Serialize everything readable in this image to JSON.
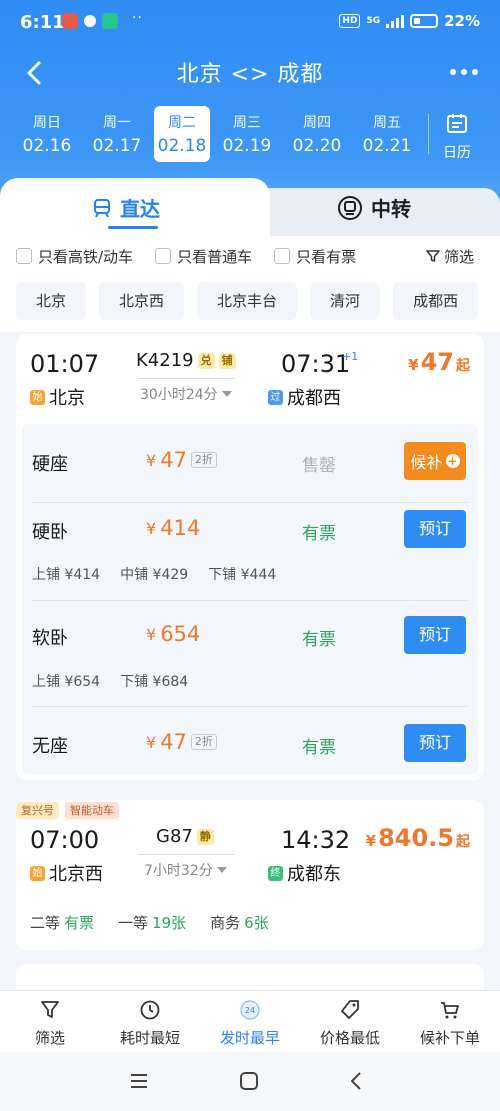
{
  "status_bar": {
    "time": "6:11",
    "network_label": "HD",
    "network_type": "5G",
    "battery": "22%",
    "more_dots": "··"
  },
  "nav": {
    "title": "北京 <> 成都",
    "back_icon": "back-arrow-icon",
    "more_icon": "more-dots-icon"
  },
  "dates": [
    {
      "weekday": "周日",
      "date": "02.16",
      "selected": false
    },
    {
      "weekday": "周一",
      "date": "02.17",
      "selected": false
    },
    {
      "weekday": "周二",
      "date": "02.18",
      "selected": true
    },
    {
      "weekday": "周三",
      "date": "02.19",
      "selected": false
    },
    {
      "weekday": "周四",
      "date": "02.20",
      "selected": false
    },
    {
      "weekday": "周五",
      "date": "02.21",
      "selected": false
    }
  ],
  "calendar_label": "日历",
  "tabs": {
    "direct": "直达",
    "transfer": "中转"
  },
  "filters": {
    "high_speed": "只看高铁/动车",
    "normal": "只看普通车",
    "available": "只看有票",
    "filter_btn": "筛选"
  },
  "stations": [
    "北京",
    "北京西",
    "北京丰台",
    "清河",
    "成都西"
  ],
  "train1": {
    "depart_time": "01:07",
    "depart_station": "北京",
    "depart_tag": "始",
    "number": "K4219",
    "tag_exchange": "兑",
    "tag_berth": "铺",
    "duration": "30小时24分",
    "arrive_time": "07:31",
    "arrive_plus": "+1",
    "arrive_station": "成都西",
    "arrive_tag": "过",
    "price_currency": "¥",
    "price": "47",
    "price_suffix": "起",
    "seats": [
      {
        "name": "硬座",
        "currency": "¥",
        "price": "47",
        "discount": "2折",
        "status": "售罄",
        "action": "候补"
      },
      {
        "name": "硬卧",
        "currency": "¥",
        "price": "414",
        "status": "有票",
        "action": "预订",
        "berths": [
          "上铺 ¥414",
          "中铺 ¥429",
          "下铺 ¥444"
        ]
      },
      {
        "name": "软卧",
        "currency": "¥",
        "price": "654",
        "status": "有票",
        "action": "预订",
        "berths": [
          "上铺 ¥654",
          "下铺 ¥684"
        ]
      },
      {
        "name": "无座",
        "currency": "¥",
        "price": "47",
        "discount": "2折",
        "status": "有票",
        "action": "预订"
      }
    ]
  },
  "train2": {
    "tag1": "复兴号",
    "tag2": "智能动车",
    "depart_time": "07:00",
    "depart_station": "北京西",
    "depart_tag": "始",
    "number": "G87",
    "tag_quiet": "静",
    "duration": "7小时32分",
    "arrive_time": "14:32",
    "arrive_station": "成都东",
    "arrive_tag": "终",
    "price_currency": "¥",
    "price": "840.5",
    "price_suffix": "起",
    "classes": [
      {
        "name": "二等",
        "status": "有票"
      },
      {
        "name": "一等",
        "status": "19张"
      },
      {
        "name": "商务",
        "status": "6张"
      }
    ]
  },
  "bottom_tabs": [
    {
      "label": "筛选",
      "icon": "filter-icon",
      "selected": false
    },
    {
      "label": "耗时最短",
      "icon": "clock-icon",
      "selected": false
    },
    {
      "label": "发时最早",
      "icon": "24h-icon",
      "selected": true
    },
    {
      "label": "价格最低",
      "icon": "price-tag-icon",
      "selected": false
    },
    {
      "label": "候补下单",
      "icon": "cart-icon",
      "selected": false
    }
  ],
  "colors": {
    "primary": "#2f8cf3",
    "price": "#f0782c",
    "available": "#2fa460",
    "wait": "#f38b1e"
  }
}
